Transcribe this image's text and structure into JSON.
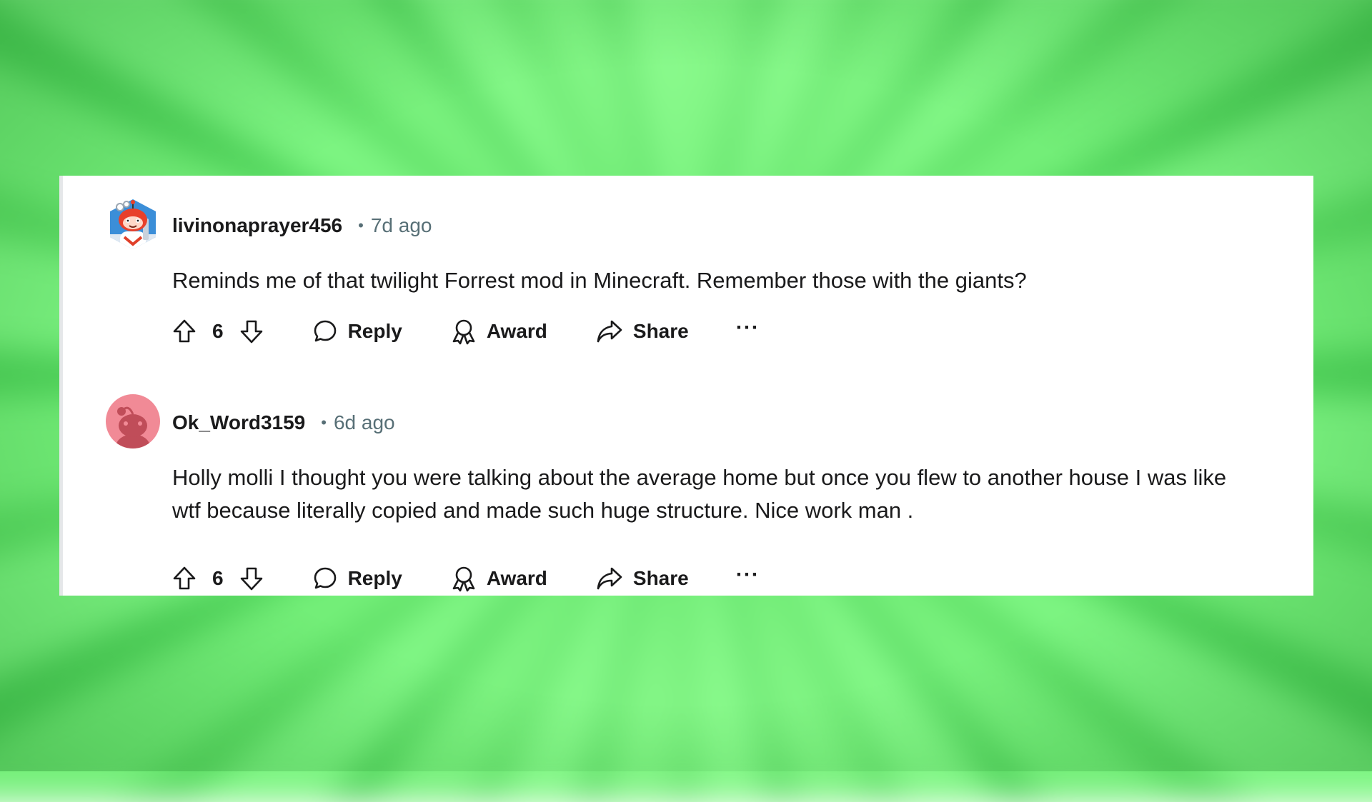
{
  "colors": {
    "background_green": "#6ee774",
    "card": "#ffffff",
    "text_primary": "#1a1a1b",
    "text_secondary": "#576f76",
    "avatar2_pink": "#f18a96"
  },
  "comments": [
    {
      "username": "livinonaprayer456",
      "separator": "•",
      "time": "7d ago",
      "avatar_icon": "snoo-avatar-red-icon",
      "body": "Reminds me of that twilight Forrest mod in Minecraft. Remember those with the giants?",
      "votes": "6",
      "actions": {
        "reply": "Reply",
        "award": "Award",
        "share": "Share",
        "more": "···"
      }
    },
    {
      "username": "Ok_Word3159",
      "separator": "•",
      "time": "6d ago",
      "avatar_icon": "snoo-avatar-default-icon",
      "body": "Holly molli I thought you were talking about the average home but once you flew to another house I was like wtf because literally copied and made such huge structure. Nice work man .",
      "votes": "6",
      "actions": {
        "reply": "Reply",
        "award": "Award",
        "share": "Share",
        "more": "···"
      }
    }
  ]
}
